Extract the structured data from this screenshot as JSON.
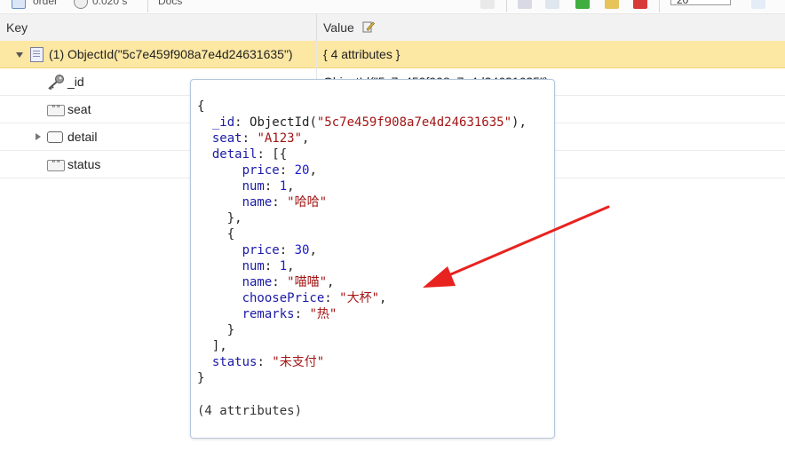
{
  "toolbar": {
    "collection_label": "order",
    "time_label": "0.020 s",
    "docs_label": "Docs",
    "page_size_value": "20"
  },
  "grid": {
    "columns": [
      "Key",
      "Value"
    ],
    "rows": [
      {
        "key": "(1) ObjectId(\"5c7e459f908a7e4d24631635\")",
        "value": "{ 4 attributes }",
        "selected": true
      },
      {
        "key": "_id",
        "value": "ObjectId(\"5c7e459f908a7e4d24631635\")"
      },
      {
        "key": "seat",
        "value": ""
      },
      {
        "key": "detail",
        "value": ""
      },
      {
        "key": "status",
        "value": ""
      }
    ]
  },
  "tooltip": {
    "lines": [
      [
        {
          "t": "{"
        }
      ],
      [
        {
          "t": "  "
        },
        {
          "t": "_id",
          "c": "k"
        },
        {
          "t": ": ObjectId("
        },
        {
          "t": "\"5c7e459f908a7e4d24631635\"",
          "c": "s"
        },
        {
          "t": "),"
        }
      ],
      [
        {
          "t": "  "
        },
        {
          "t": "seat",
          "c": "k"
        },
        {
          "t": ": "
        },
        {
          "t": "\"A123\"",
          "c": "s"
        },
        {
          "t": ","
        }
      ],
      [
        {
          "t": "  "
        },
        {
          "t": "detail",
          "c": "k"
        },
        {
          "t": ": [{"
        }
      ],
      [
        {
          "t": "      "
        },
        {
          "t": "price",
          "c": "k"
        },
        {
          "t": ": "
        },
        {
          "t": "20",
          "c": "n"
        },
        {
          "t": ","
        }
      ],
      [
        {
          "t": "      "
        },
        {
          "t": "num",
          "c": "k"
        },
        {
          "t": ": "
        },
        {
          "t": "1",
          "c": "n"
        },
        {
          "t": ","
        }
      ],
      [
        {
          "t": "      "
        },
        {
          "t": "name",
          "c": "k"
        },
        {
          "t": ": "
        },
        {
          "t": "\"哈哈\"",
          "c": "s"
        }
      ],
      [
        {
          "t": "    },"
        }
      ],
      [
        {
          "t": "    {"
        }
      ],
      [
        {
          "t": "      "
        },
        {
          "t": "price",
          "c": "k"
        },
        {
          "t": ": "
        },
        {
          "t": "30",
          "c": "n"
        },
        {
          "t": ","
        }
      ],
      [
        {
          "t": "      "
        },
        {
          "t": "num",
          "c": "k"
        },
        {
          "t": ": "
        },
        {
          "t": "1",
          "c": "n"
        },
        {
          "t": ","
        }
      ],
      [
        {
          "t": "      "
        },
        {
          "t": "name",
          "c": "k"
        },
        {
          "t": ": "
        },
        {
          "t": "\"喵喵\"",
          "c": "s"
        },
        {
          "t": ","
        }
      ],
      [
        {
          "t": "      "
        },
        {
          "t": "choosePrice",
          "c": "k"
        },
        {
          "t": ": "
        },
        {
          "t": "\"大杯\"",
          "c": "s"
        },
        {
          "t": ","
        }
      ],
      [
        {
          "t": "      "
        },
        {
          "t": "remarks",
          "c": "k"
        },
        {
          "t": ": "
        },
        {
          "t": "\"热\"",
          "c": "s"
        }
      ],
      [
        {
          "t": "    }"
        }
      ],
      [
        {
          "t": "  ],"
        }
      ],
      [
        {
          "t": "  "
        },
        {
          "t": "status",
          "c": "k"
        },
        {
          "t": ": "
        },
        {
          "t": "\"未支付\"",
          "c": "s"
        }
      ],
      [
        {
          "t": "}"
        }
      ]
    ],
    "footer": "(4 attributes)"
  },
  "colors": {
    "selected_row": "#fce7a3",
    "arrow": "#e8221e",
    "key_color": "#1a1aa6",
    "string_color": "#a31515"
  },
  "icons": {
    "toolbar": [
      "table-icon",
      "clock-icon",
      "tree-view-icon",
      "find-icon",
      "export-icon",
      "add-document-icon",
      "edit-document-icon",
      "delete-document-icon",
      "pin-icon"
    ],
    "rows": [
      "document-icon",
      "key-icon",
      "string-icon",
      "object-icon",
      "string-icon"
    ],
    "value_header": "edit-icon"
  }
}
